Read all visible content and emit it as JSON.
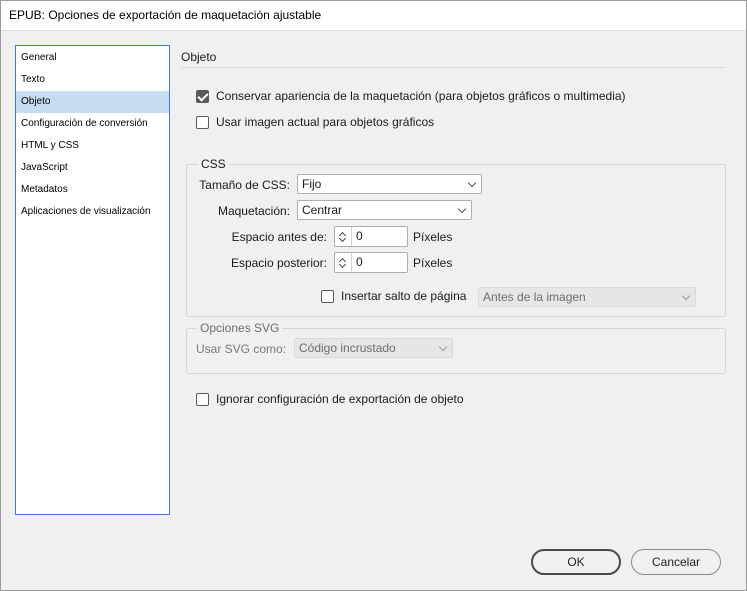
{
  "window": {
    "title": "EPUB: Opciones de exportación de maquetación ajustable"
  },
  "sidebar": {
    "items": [
      {
        "label": "General"
      },
      {
        "label": "Texto"
      },
      {
        "label": "Objeto"
      },
      {
        "label": "Configuración de conversión"
      },
      {
        "label": "HTML y CSS"
      },
      {
        "label": "JavaScript"
      },
      {
        "label": "Metadatos"
      },
      {
        "label": "Aplicaciones de visualización"
      }
    ],
    "selected": "Objeto"
  },
  "section": {
    "title": "Objeto"
  },
  "options": {
    "preserve_appearance": {
      "label": "Conservar apariencia de la maquetación (para objetos gráficos o multimedia)",
      "checked": true
    },
    "use_current_image": {
      "label": "Usar imagen actual para objetos gráficos",
      "checked": false
    }
  },
  "css_group": {
    "legend": "CSS",
    "size_label": "Tamaño de CSS:",
    "size_value": "Fijo",
    "layout_label": "Maquetación:",
    "layout_value": "Centrar",
    "space_before_label": "Espacio antes de:",
    "space_before_value": "0",
    "space_before_unit": "Píxeles",
    "space_after_label": "Espacio posterior:",
    "space_after_value": "0",
    "space_after_unit": "Píxeles",
    "page_break_label": "Insertar salto de página",
    "page_break_checked": false,
    "page_break_value": "Antes de la imagen"
  },
  "svg_group": {
    "legend": "Opciones SVG",
    "use_as_label": "Usar SVG como:",
    "use_as_value": "Código incrustado"
  },
  "ignore_export": {
    "label": "Ignorar configuración de exportación de objeto",
    "checked": false
  },
  "buttons": {
    "ok": "OK",
    "cancel": "Cancelar"
  }
}
